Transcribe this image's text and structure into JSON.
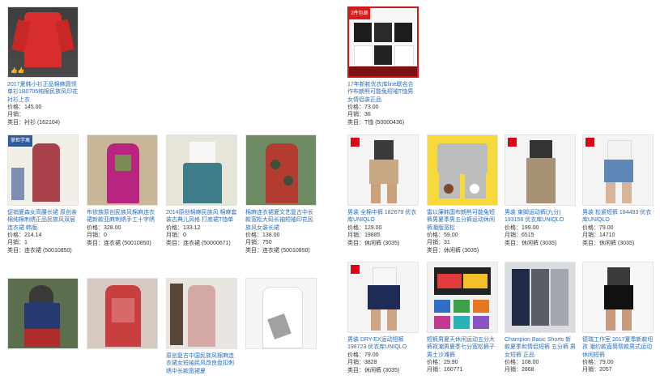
{
  "products": [
    {
      "id": "p1",
      "title": "2017夏韩小衫正品棉麻圆领单衫1B0705纯棉民族风印花衬衫上衣",
      "price_label": "价格：",
      "price": "145.00",
      "sales_label": "月销：",
      "sales": "",
      "category_label": "类目：",
      "category": "衬衫 (162104)"
    },
    {
      "id": "p2",
      "title": "17年新款优衣库line联名合作布朗熊可能兔短袖T恤男女情侣装正品",
      "price_label": "价格：",
      "price": "73.00",
      "sales_label": "月销：",
      "sales": "36",
      "category_label": "类目：",
      "category": "T恤 (50000436)",
      "badge": "2件包邮"
    },
    {
      "id": "p3",
      "title": "促销夏森女高腰长裙 原创亲棉纯棉刺绣正品民族风双层连衣裙 韩版",
      "price_label": "价格：",
      "price": "214.14",
      "sales_label": "月销：",
      "sales": "1",
      "category_label": "类目：",
      "category": "连衣裙 (50010850)",
      "badge": "掌柜学寓"
    },
    {
      "id": "p4",
      "title": "布依族原创民族风棉麻连衣裙新款亚麻刺绣手工十字绣连衣裙",
      "price_label": "价格：",
      "price": "328.00",
      "sales_label": "月销：",
      "sales": "0",
      "category_label": "类目：",
      "category": "连衣裙 (50010850)"
    },
    {
      "id": "p5",
      "title": "2014原创棉麻民族风 棉麻套装古典儿风格 打底裙T恤单衫正品",
      "price_label": "价格：",
      "price": "133.12",
      "sales_label": "月销：",
      "sales": "0",
      "category_label": "类目：",
      "category": "连衣裙 (50000671)"
    },
    {
      "id": "p6",
      "title": "棉麻连衣裙夏文艺复古中长款宽松大码长袖短袖印花民族风女装长裙",
      "price_label": "价格：",
      "price": "138.00",
      "sales_label": "月销：",
      "sales": "750",
      "category_label": "类目：",
      "category": "连衣裙 (50010850)"
    },
    {
      "id": "p7",
      "title": "男装 全棉中裤 182679 优衣库UNIQLO",
      "price_label": "价格：",
      "price": "129.00",
      "sales_label": "月销：",
      "sales": "19885",
      "category_label": "类目：",
      "category": "休闲裤 (3035)"
    },
    {
      "id": "p8",
      "title": "雷以廉韩国布朗熊可能兔短裤男夏季男五分裤运动休闲裤潮版宽松",
      "price_label": "价格：",
      "price": "59.00",
      "sales_label": "月销：",
      "sales": "31",
      "category_label": "类目：",
      "category": "休闲裤 (3035)"
    },
    {
      "id": "p9",
      "title": "男装 束脚运动裤(九分) 193156 优衣库UNIQLO",
      "price_label": "价格：",
      "price": "199.00",
      "sales_label": "月销：",
      "sales": "6515",
      "category_label": "类目：",
      "category": "休闲裤 (3035)"
    },
    {
      "id": "p10",
      "title": "男装 松紧短裤 184493 优衣库UNIQLO",
      "price_label": "价格：",
      "price": "79.00",
      "sales_label": "月销：",
      "sales": "14710",
      "category_label": "类目：",
      "category": "休闲裤 (3035)"
    },
    {
      "id": "p11",
      "title": "",
      "price_label": "",
      "price": "",
      "sales_label": "",
      "sales": "",
      "category_label": "",
      "category": ""
    },
    {
      "id": "p12",
      "title": "",
      "price_label": "",
      "price": "",
      "sales_label": "",
      "sales": "",
      "category_label": "",
      "category": ""
    },
    {
      "id": "p13",
      "title": "原创复古中国民族风棉麻连衣裙女短袖民风改良盘扣刺绣中长款宽裙夏",
      "price_label": "",
      "price": "",
      "sales_label": "",
      "sales": "",
      "category_label": "",
      "category": ""
    },
    {
      "id": "p14",
      "title": "",
      "price_label": "",
      "price": "",
      "sales_label": "",
      "sales": "",
      "category_label": "",
      "category": ""
    },
    {
      "id": "p15",
      "title": "男装 DRY-EX运动短裤 198723 优衣库UNIQLO",
      "price_label": "价格：",
      "price": "79.00",
      "sales_label": "月销：",
      "sales": "3828",
      "category_label": "类目：",
      "category": "休闲裤 (3035)"
    },
    {
      "id": "p16",
      "title": "短裤男夏天休闲运动五分大裤衩潮男夏季七分宽松裤子男士沙滩裤",
      "price_label": "价格：",
      "price": "29.90",
      "sales_label": "月销：",
      "sales": "160771",
      "category_label": "",
      "category": ""
    },
    {
      "id": "p17",
      "title": "Champion Basic Shorts 新款夏季和情侣短裤 五分裤 男女短裤 正品",
      "price_label": "价格：",
      "price": "108.00",
      "sales_label": "月销：",
      "sales": "2868",
      "category_label": "",
      "category": ""
    },
    {
      "id": "p18",
      "title": "德瑞工作室 2017夏季新款纽孩 潮约款直筒帮款男式运动休闲短裤",
      "price_label": "价格：",
      "price": "79.00",
      "sales_label": "月销：",
      "sales": "2057",
      "category_label": "",
      "category": ""
    }
  ],
  "thumb_labels": {
    "uniqlo_text": "UNIQLO",
    "like_text": "👍👍"
  }
}
